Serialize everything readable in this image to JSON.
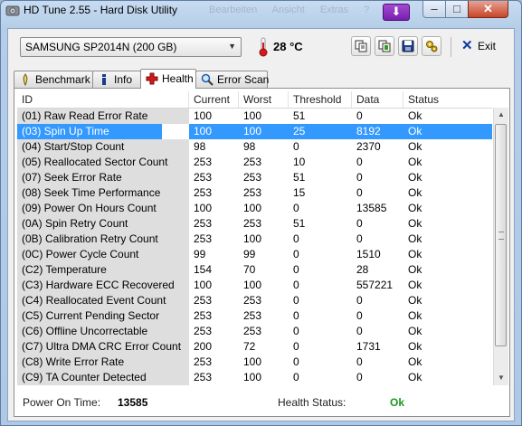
{
  "window": {
    "title": "HD Tune 2.55 - Hard Disk Utility",
    "ghost_menu": [
      "Bearbeiten",
      "Ansicht",
      "Extras",
      "?"
    ],
    "buttons": {
      "minimize": "–",
      "maximize": "□",
      "close": "✕",
      "download": "⬇"
    }
  },
  "toolbar": {
    "drive": "SAMSUNG SP2014N (200 GB)",
    "temperature": "28 °C",
    "icons": [
      "copy-icon",
      "copy-info-icon",
      "save-icon",
      "options-icon"
    ],
    "exit_label": "Exit"
  },
  "tabs": [
    {
      "label": "Benchmark",
      "icon": "benchmark-icon"
    },
    {
      "label": "Info",
      "icon": "info-icon"
    },
    {
      "label": "Health",
      "icon": "health-cross-icon",
      "active": true
    },
    {
      "label": "Error Scan",
      "icon": "magnifier-icon"
    }
  ],
  "table": {
    "columns": [
      "ID",
      "Current",
      "Worst",
      "Threshold",
      "Data",
      "Status"
    ],
    "selected_index": 1,
    "rows": [
      [
        "(01) Raw Read Error Rate",
        "100",
        "100",
        "51",
        "0",
        "Ok"
      ],
      [
        "(03) Spin Up Time",
        "100",
        "100",
        "25",
        "8192",
        "Ok"
      ],
      [
        "(04) Start/Stop Count",
        "98",
        "98",
        "0",
        "2370",
        "Ok"
      ],
      [
        "(05) Reallocated Sector Count",
        "253",
        "253",
        "10",
        "0",
        "Ok"
      ],
      [
        "(07) Seek Error Rate",
        "253",
        "253",
        "51",
        "0",
        "Ok"
      ],
      [
        "(08) Seek Time Performance",
        "253",
        "253",
        "15",
        "0",
        "Ok"
      ],
      [
        "(09) Power On Hours Count",
        "100",
        "100",
        "0",
        "13585",
        "Ok"
      ],
      [
        "(0A) Spin Retry Count",
        "253",
        "253",
        "51",
        "0",
        "Ok"
      ],
      [
        "(0B) Calibration Retry Count",
        "253",
        "100",
        "0",
        "0",
        "Ok"
      ],
      [
        "(0C) Power Cycle Count",
        "99",
        "99",
        "0",
        "1510",
        "Ok"
      ],
      [
        "(C2) Temperature",
        "154",
        "70",
        "0",
        "28",
        "Ok"
      ],
      [
        "(C3) Hardware ECC Recovered",
        "100",
        "100",
        "0",
        "557221",
        "Ok"
      ],
      [
        "(C4) Reallocated Event Count",
        "253",
        "253",
        "0",
        "0",
        "Ok"
      ],
      [
        "(C5) Current Pending Sector",
        "253",
        "253",
        "0",
        "0",
        "Ok"
      ],
      [
        "(C6) Offline Uncorrectable",
        "253",
        "253",
        "0",
        "0",
        "Ok"
      ],
      [
        "(C7) Ultra DMA CRC Error Count",
        "200",
        "72",
        "0",
        "1731",
        "Ok"
      ],
      [
        "(C8) Write Error Rate",
        "253",
        "100",
        "0",
        "0",
        "Ok"
      ],
      [
        "(C9) TA Counter Detected",
        "253",
        "100",
        "0",
        "0",
        "Ok"
      ]
    ]
  },
  "footer": {
    "power_on_label": "Power On Time:",
    "power_on_value": "13585",
    "health_label": "Health Status:",
    "health_value": "Ok",
    "health_color": "#1a9a1a"
  }
}
